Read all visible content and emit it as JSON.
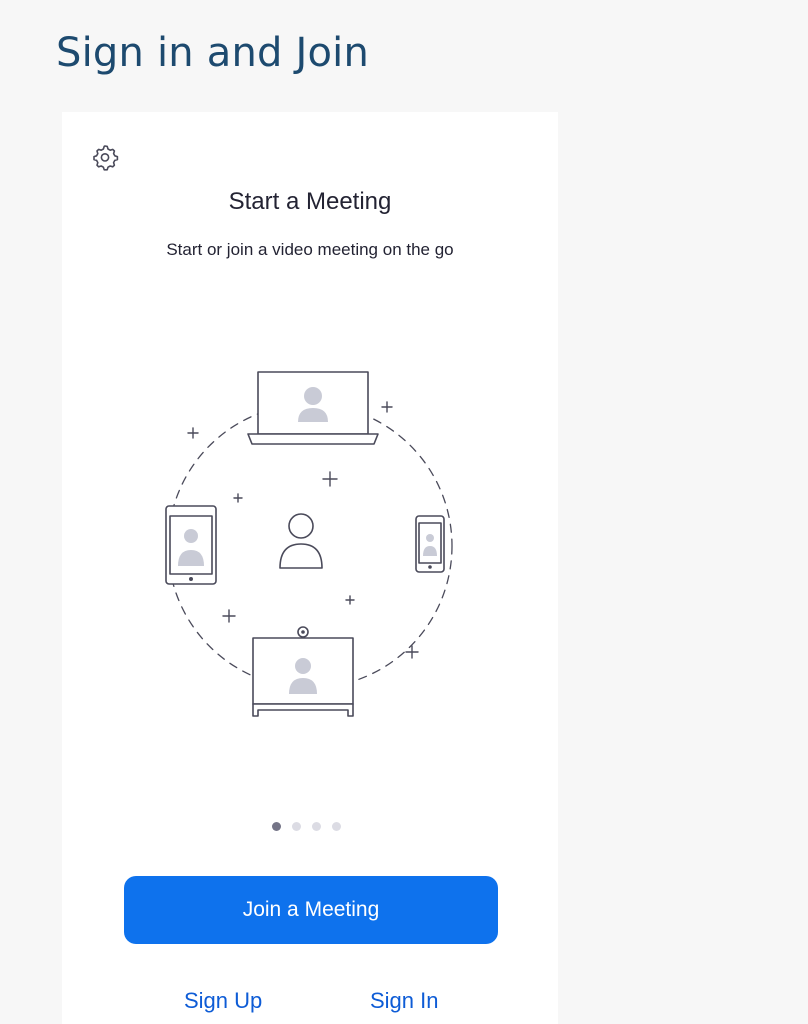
{
  "page": {
    "title": "Sign in and Join"
  },
  "app": {
    "settings_icon": "gear-icon",
    "hero": {
      "title": "Start a Meeting",
      "subtitle": "Start or join a video meeting on the go"
    },
    "carousel": {
      "total_pages": 4,
      "active_index": 0
    },
    "join_button_label": "Join a Meeting",
    "sign_up_label": "Sign Up",
    "sign_in_label": "Sign In"
  },
  "colors": {
    "title": "#1d4a6f",
    "primary_button": "#0e72ed",
    "link": "#0e5cd6",
    "illustration_stroke": "#4a4a5a",
    "illustration_fill": "#c9cbd6"
  }
}
